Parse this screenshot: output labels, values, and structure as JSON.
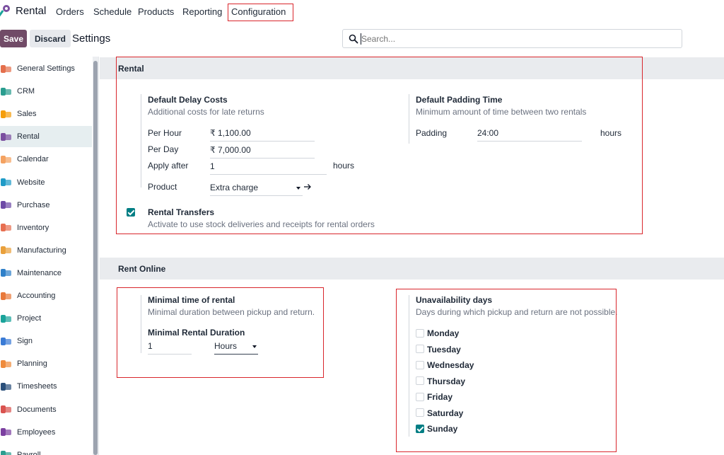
{
  "nav": {
    "app_name": "Rental",
    "items": [
      "Orders",
      "Schedule",
      "Products",
      "Reporting",
      "Configuration"
    ]
  },
  "control": {
    "save_label": "Save",
    "discard_label": "Discard",
    "title": "Settings",
    "search_placeholder": "Search..."
  },
  "sidebar": {
    "items": [
      {
        "label": "General Settings",
        "icon": "general-settings-icon",
        "color": "#e46f4c"
      },
      {
        "label": "CRM",
        "icon": "crm-icon",
        "color": "#2a9d8f"
      },
      {
        "label": "Sales",
        "icon": "sales-icon",
        "color": "#f59e0b"
      },
      {
        "label": "Rental",
        "icon": "rental-icon",
        "color": "#7b4fa0"
      },
      {
        "label": "Calendar",
        "icon": "calendar-icon",
        "color": "#f4a261"
      },
      {
        "label": "Website",
        "icon": "website-icon",
        "color": "#1f9bc7"
      },
      {
        "label": "Purchase",
        "icon": "purchase-icon",
        "color": "#6d4aa6"
      },
      {
        "label": "Inventory",
        "icon": "inventory-icon",
        "color": "#e76f51"
      },
      {
        "label": "Manufacturing",
        "icon": "manufacturing-icon",
        "color": "#e9a03b"
      },
      {
        "label": "Maintenance",
        "icon": "maintenance-icon",
        "color": "#2f80c9"
      },
      {
        "label": "Accounting",
        "icon": "accounting-icon",
        "color": "#e8793b"
      },
      {
        "label": "Project",
        "icon": "project-icon",
        "color": "#1aa39a"
      },
      {
        "label": "Sign",
        "icon": "sign-icon",
        "color": "#3a7bd5"
      },
      {
        "label": "Planning",
        "icon": "planning-icon",
        "color": "#ef8b3c"
      },
      {
        "label": "Timesheets",
        "icon": "timesheets-icon",
        "color": "#2a4f7a"
      },
      {
        "label": "Documents",
        "icon": "documents-icon",
        "color": "#d9534f"
      },
      {
        "label": "Employees",
        "icon": "employees-icon",
        "color": "#7b3fa0"
      },
      {
        "label": "Payroll",
        "icon": "payroll-icon",
        "color": "#2a9d8f"
      }
    ],
    "active_index": 3
  },
  "rental": {
    "section_title": "Rental",
    "delay_costs": {
      "title": "Default Delay Costs",
      "desc": "Additional costs for late returns",
      "per_hour_label": "Per Hour",
      "per_hour_value": "₹ 1,100.00",
      "per_day_label": "Per Day",
      "per_day_value": "₹ 7,000.00",
      "apply_after_label": "Apply after",
      "apply_after_value": "1",
      "apply_after_unit": "hours",
      "product_label": "Product",
      "product_value": "Extra charge"
    },
    "padding": {
      "title": "Default Padding Time",
      "desc": "Minimum amount of time between two rentals",
      "label": "Padding",
      "value": "24:00",
      "unit": "hours"
    },
    "transfers": {
      "title": "Rental Transfers",
      "desc": "Activate to use stock deliveries and receipts for rental orders",
      "checked": true
    }
  },
  "rent_online": {
    "section_title": "Rent Online",
    "minimal_time": {
      "title": "Minimal time of rental",
      "desc": "Minimal duration between pickup and return.",
      "duration_label": "Minimal Rental Duration",
      "duration_value": "1",
      "duration_unit": "Hours"
    },
    "unavailability": {
      "title": "Unavailability days",
      "desc": "Days during which pickup and return are not possible.",
      "days": [
        {
          "label": "Monday",
          "checked": false
        },
        {
          "label": "Tuesday",
          "checked": false
        },
        {
          "label": "Wednesday",
          "checked": false
        },
        {
          "label": "Thursday",
          "checked": false
        },
        {
          "label": "Friday",
          "checked": false
        },
        {
          "label": "Saturday",
          "checked": false
        },
        {
          "label": "Sunday",
          "checked": true
        }
      ]
    }
  },
  "colors": {
    "brand": "#714b67",
    "accent": "#017e84",
    "highlight": "#d9262c"
  }
}
